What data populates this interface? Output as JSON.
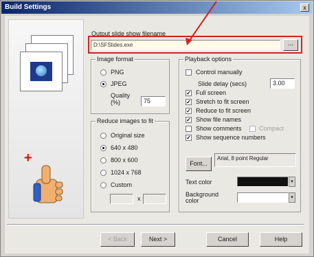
{
  "window": {
    "title": "Build Settings",
    "close_glyph": "x"
  },
  "output": {
    "label": "Output slide show filename",
    "value": "D:\\SFSlides.exe",
    "browse_label": "..."
  },
  "image_format": {
    "title": "Image format",
    "options": [
      {
        "label": "PNG",
        "selected": false
      },
      {
        "label": "JPEG",
        "selected": true
      }
    ],
    "quality_label": "Quality (%)",
    "quality_value": "75"
  },
  "reduce": {
    "title": "Reduce images to fit",
    "options": [
      {
        "label": "Original size",
        "selected": false
      },
      {
        "label": "640 x 480",
        "selected": true
      },
      {
        "label": "800 x 600",
        "selected": false
      },
      {
        "label": "1024 x 768",
        "selected": false
      },
      {
        "label": "Custom",
        "selected": false
      }
    ],
    "custom_sep": "x"
  },
  "playback": {
    "title": "Playback options",
    "control_manually": "Control manually",
    "slide_delay_label": "Slide delay (secs)",
    "slide_delay_value": "3.00",
    "checks": [
      {
        "label": "Full screen",
        "checked": true
      },
      {
        "label": "Stretch to fit screen",
        "checked": true
      },
      {
        "label": "Reduce to fit screen",
        "checked": true
      },
      {
        "label": "Show file names",
        "checked": true
      },
      {
        "label": "Show comments",
        "checked": false
      },
      {
        "label": "Show sequence numbers",
        "checked": true
      }
    ],
    "compact_label": "Compact",
    "font_button": "Font...",
    "font_desc": "Arial, 8 point Regular",
    "text_color_label": "Text color",
    "text_color": "#111111",
    "bg_color_label": "Background color",
    "bg_color": "#ffffff"
  },
  "buttons": {
    "back": "< Back",
    "next": "Next >",
    "cancel": "Cancel",
    "help": "Help"
  },
  "colors": {
    "highlight": "#d32222",
    "titlebar": "#0a246a"
  }
}
